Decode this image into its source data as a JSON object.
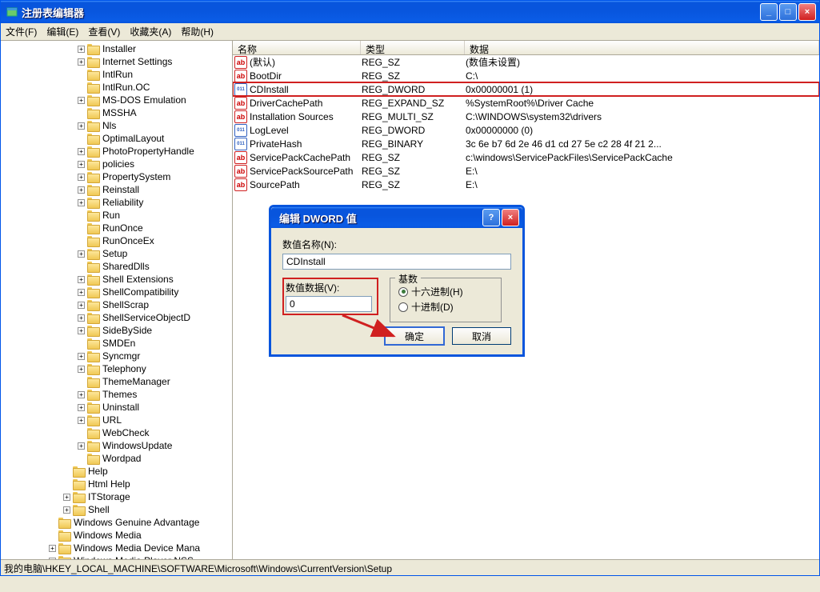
{
  "window": {
    "title": "注册表编辑器",
    "minimize": "_",
    "maximize": "□",
    "close": "×"
  },
  "menu": {
    "file": "文件(F)",
    "edit": "编辑(E)",
    "view": "查看(V)",
    "favorites": "收藏夹(A)",
    "help": "帮助(H)"
  },
  "columns": {
    "name": "名称",
    "type": "类型",
    "data": "数据"
  },
  "tree": [
    {
      "indent": 5,
      "exp": "+",
      "label": "Installer"
    },
    {
      "indent": 5,
      "exp": "+",
      "label": "Internet Settings"
    },
    {
      "indent": 5,
      "exp": "",
      "label": "IntlRun"
    },
    {
      "indent": 5,
      "exp": "",
      "label": "IntlRun.OC"
    },
    {
      "indent": 5,
      "exp": "+",
      "label": "MS-DOS Emulation"
    },
    {
      "indent": 5,
      "exp": "",
      "label": "MSSHA"
    },
    {
      "indent": 5,
      "exp": "+",
      "label": "Nls"
    },
    {
      "indent": 5,
      "exp": "",
      "label": "OptimalLayout"
    },
    {
      "indent": 5,
      "exp": "+",
      "label": "PhotoPropertyHandle"
    },
    {
      "indent": 5,
      "exp": "+",
      "label": "policies"
    },
    {
      "indent": 5,
      "exp": "+",
      "label": "PropertySystem"
    },
    {
      "indent": 5,
      "exp": "+",
      "label": "Reinstall"
    },
    {
      "indent": 5,
      "exp": "+",
      "label": "Reliability"
    },
    {
      "indent": 5,
      "exp": "",
      "label": "Run"
    },
    {
      "indent": 5,
      "exp": "",
      "label": "RunOnce"
    },
    {
      "indent": 5,
      "exp": "",
      "label": "RunOnceEx"
    },
    {
      "indent": 5,
      "exp": "+",
      "label": "Setup"
    },
    {
      "indent": 5,
      "exp": "",
      "label": "SharedDlls"
    },
    {
      "indent": 5,
      "exp": "+",
      "label": "Shell Extensions"
    },
    {
      "indent": 5,
      "exp": "+",
      "label": "ShellCompatibility"
    },
    {
      "indent": 5,
      "exp": "+",
      "label": "ShellScrap"
    },
    {
      "indent": 5,
      "exp": "+",
      "label": "ShellServiceObjectD"
    },
    {
      "indent": 5,
      "exp": "+",
      "label": "SideBySide"
    },
    {
      "indent": 5,
      "exp": "",
      "label": "SMDEn"
    },
    {
      "indent": 5,
      "exp": "+",
      "label": "Syncmgr"
    },
    {
      "indent": 5,
      "exp": "+",
      "label": "Telephony"
    },
    {
      "indent": 5,
      "exp": "",
      "label": "ThemeManager"
    },
    {
      "indent": 5,
      "exp": "+",
      "label": "Themes"
    },
    {
      "indent": 5,
      "exp": "+",
      "label": "Uninstall"
    },
    {
      "indent": 5,
      "exp": "+",
      "label": "URL"
    },
    {
      "indent": 5,
      "exp": "",
      "label": "WebCheck"
    },
    {
      "indent": 5,
      "exp": "+",
      "label": "WindowsUpdate"
    },
    {
      "indent": 5,
      "exp": "",
      "label": "Wordpad"
    },
    {
      "indent": 4,
      "exp": "",
      "label": "Help"
    },
    {
      "indent": 4,
      "exp": "",
      "label": "Html Help"
    },
    {
      "indent": 4,
      "exp": "+",
      "label": "ITStorage"
    },
    {
      "indent": 4,
      "exp": "+",
      "label": "Shell"
    },
    {
      "indent": 3,
      "exp": "",
      "label": "Windows Genuine Advantage"
    },
    {
      "indent": 3,
      "exp": "",
      "label": "Windows Media"
    },
    {
      "indent": 3,
      "exp": "+",
      "label": "Windows Media Device Mana"
    },
    {
      "indent": 3,
      "exp": "+",
      "label": "Windows Media Player NSS"
    }
  ],
  "values": [
    {
      "icon": "str",
      "name": "(默认)",
      "type": "REG_SZ",
      "data": "(数值未设置)",
      "hl": false
    },
    {
      "icon": "str",
      "name": "BootDir",
      "type": "REG_SZ",
      "data": "C:\\",
      "hl": false
    },
    {
      "icon": "bin",
      "name": "CDInstall",
      "type": "REG_DWORD",
      "data": "0x00000001 (1)",
      "hl": true
    },
    {
      "icon": "str",
      "name": "DriverCachePath",
      "type": "REG_EXPAND_SZ",
      "data": "%SystemRoot%\\Driver Cache",
      "hl": false
    },
    {
      "icon": "str",
      "name": "Installation Sources",
      "type": "REG_MULTI_SZ",
      "data": "C:\\WINDOWS\\system32\\drivers",
      "hl": false
    },
    {
      "icon": "bin",
      "name": "LogLevel",
      "type": "REG_DWORD",
      "data": "0x00000000 (0)",
      "hl": false
    },
    {
      "icon": "bin",
      "name": "PrivateHash",
      "type": "REG_BINARY",
      "data": "3c 6e b7 6d 2e 46 d1 cd 27 5e c2 28 4f 21 2...",
      "hl": false
    },
    {
      "icon": "str",
      "name": "ServicePackCachePath",
      "type": "REG_SZ",
      "data": "c:\\windows\\ServicePackFiles\\ServicePackCache",
      "hl": false
    },
    {
      "icon": "str",
      "name": "ServicePackSourcePath",
      "type": "REG_SZ",
      "data": "E:\\",
      "hl": false
    },
    {
      "icon": "str",
      "name": "SourcePath",
      "type": "REG_SZ",
      "data": "E:\\",
      "hl": false
    }
  ],
  "dialog": {
    "title": "编辑 DWORD 值",
    "name_label": "数值名称(N):",
    "name_value": "CDInstall",
    "data_label": "数值数据(V):",
    "data_value": "0",
    "base_label": "基数",
    "hex_label": "十六进制(H)",
    "dec_label": "十进制(D)",
    "ok": "确定",
    "cancel": "取消",
    "help": "?",
    "close": "×"
  },
  "statusbar": "我的电脑\\HKEY_LOCAL_MACHINE\\SOFTWARE\\Microsoft\\Windows\\CurrentVersion\\Setup"
}
